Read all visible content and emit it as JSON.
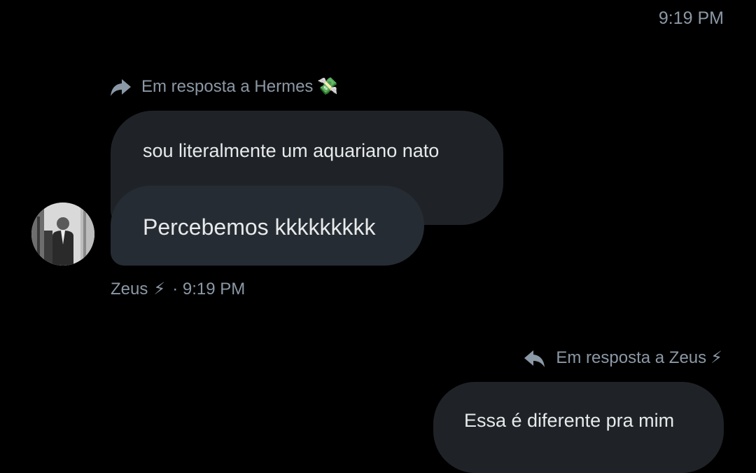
{
  "top_timestamp": "9:19 PM",
  "thread": {
    "reply_to_hermes": {
      "icon": "reply-forward-icon",
      "text": "Em resposta a Hermes",
      "emoji": "💸"
    },
    "quoted_message": "sou literalmente um aquariano nato",
    "message": "Percebemos kkkkkkkkk",
    "author": {
      "name": "Zeus",
      "emoji": "⚡",
      "time": "· 9:19 PM",
      "avatar": "avatar-photo"
    }
  },
  "own_reply": {
    "reply_to": {
      "icon": "reply-back-icon",
      "text": "Em resposta a Zeus",
      "emoji": "⚡"
    },
    "message": "Essa é diferente pra mim"
  },
  "colors": {
    "background": "#000000",
    "bubble": "#1f2327",
    "bubble_highlight": "#262c33",
    "muted_text": "#8b98a5",
    "text": "#e7e9ea"
  }
}
